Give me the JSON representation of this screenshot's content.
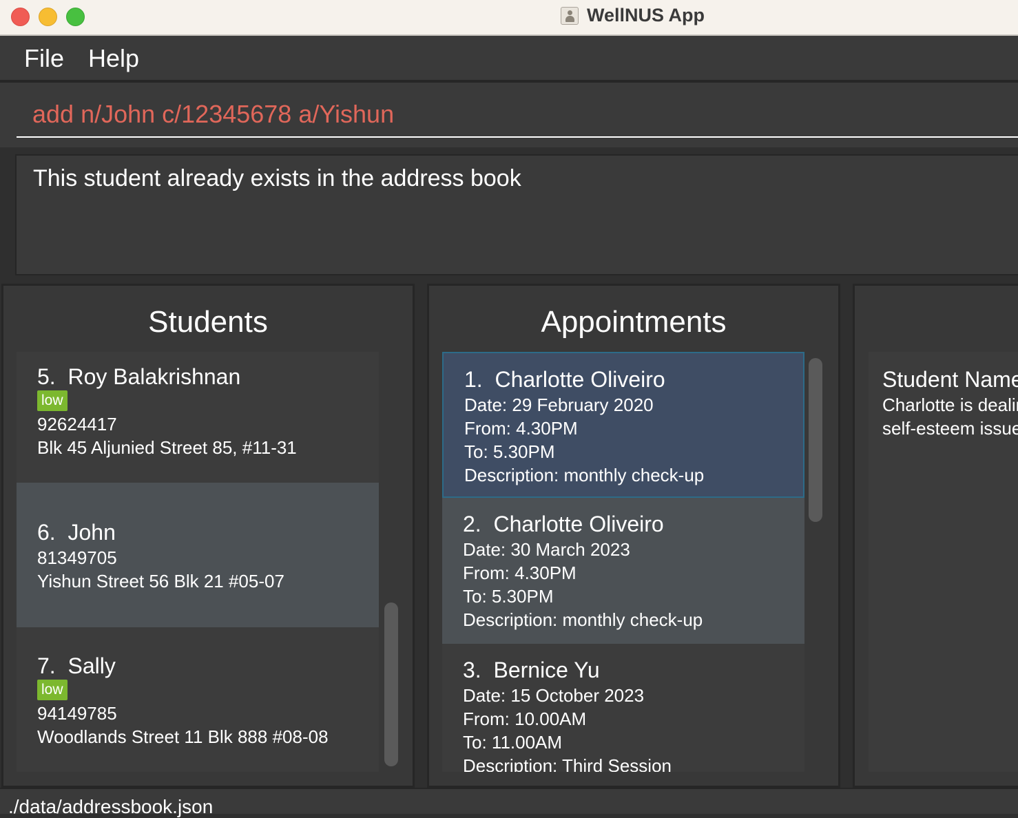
{
  "window": {
    "title": "WellNUS App"
  },
  "menu": {
    "file": "File",
    "help": "Help"
  },
  "command": {
    "value": "add n/John c/12345678 a/Yishun"
  },
  "result": {
    "message": "This student already exists in the address book"
  },
  "students": {
    "title": "Students",
    "items": [
      {
        "index": "5.",
        "name": "Roy Balakrishnan",
        "tag": "low",
        "phone": "92624417",
        "address": "Blk 45 Aljunied Street 85, #11-31"
      },
      {
        "index": "6.",
        "name": "John",
        "phone": "81349705",
        "address": "Yishun Street 56 Blk 21 #05-07"
      },
      {
        "index": "7.",
        "name": "Sally",
        "tag": "low",
        "phone": "94149785",
        "address": "Woodlands Street 11 Blk 888 #08-08"
      }
    ]
  },
  "appointments": {
    "title": "Appointments",
    "items": [
      {
        "index": "1.",
        "name": "Charlotte Oliveiro",
        "date": "Date: 29 February 2020",
        "from": "From: 4.30PM",
        "to": "To: 5.30PM",
        "description": "Description: monthly check-up"
      },
      {
        "index": "2.",
        "name": "Charlotte Oliveiro",
        "date": "Date: 30 March 2023",
        "from": "From: 4.30PM",
        "to": "To: 5.30PM",
        "description": "Description: monthly check-up"
      },
      {
        "index": "3.",
        "name": "Bernice Yu",
        "date": "Date: 15 October 2023",
        "from": "From: 10.00AM",
        "to": "To: 11.00AM",
        "description": "Description: Third Session"
      }
    ]
  },
  "detail": {
    "label": "Student Name:",
    "line1": "Charlotte is dealing",
    "line2": "self-esteem issues"
  },
  "status": {
    "path": "./data/addressbook.json"
  },
  "colors": {
    "command_text": "#e1675a",
    "tag_bg": "#7cb82f",
    "selected_bg": "#3f4d64"
  }
}
